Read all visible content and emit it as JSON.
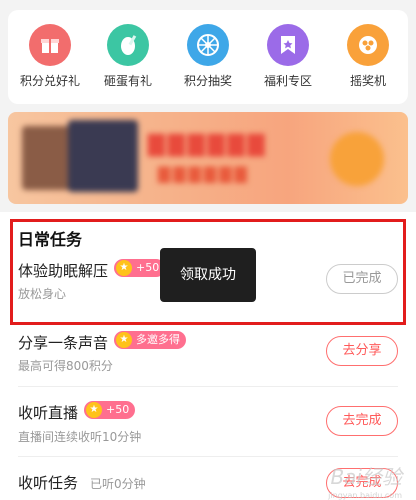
{
  "quick_actions": [
    {
      "label": "积分兑好礼",
      "icon": "gift-icon",
      "color": "#f26d6d"
    },
    {
      "label": "砸蛋有礼",
      "icon": "egg-icon",
      "color": "#3cc6a3"
    },
    {
      "label": "积分抽奖",
      "icon": "wheel-icon",
      "color": "#3ea7e8"
    },
    {
      "label": "福利专区",
      "icon": "ribbon-icon",
      "color": "#9b6be8"
    },
    {
      "label": "摇奖机",
      "icon": "lottery-icon",
      "color": "#f9a13a"
    }
  ],
  "daily_tasks": {
    "title": "日常任务",
    "items": [
      {
        "title": "体验助眠解压",
        "badge": "+50",
        "desc": "放松身心",
        "button": "已完成",
        "done": true
      },
      {
        "title": "分享一条声音",
        "badge": "多邀多得",
        "desc": "最高可得800积分",
        "button": "去分享",
        "done": false
      },
      {
        "title": "收听直播",
        "badge": "+50",
        "desc": "直播间连续收听10分钟",
        "button": "去完成",
        "done": false
      },
      {
        "title": "收听任务",
        "desc_inline": "已听0分钟",
        "button": "去完成",
        "done": false
      }
    ]
  },
  "toast": "领取成功",
  "colors": {
    "highlight": "#e21c1c",
    "badge": "#ff6f8f",
    "action_button": "#ff5a5a"
  }
}
